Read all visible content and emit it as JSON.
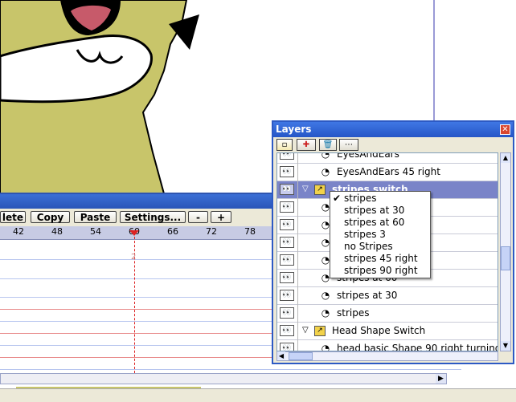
{
  "timeline": {
    "buttons": [
      "lete",
      "Copy",
      "Paste",
      "Settings...",
      "-",
      "+"
    ],
    "ruler_ticks": [
      "42",
      "48",
      "54",
      "60",
      "66",
      "72",
      "78"
    ],
    "current_frame_marker": "2"
  },
  "layers_panel": {
    "title": "Layers",
    "close_symbol": "✕",
    "toolbar_buttons": [
      {
        "icon": "new-layer-icon",
        "glyph": "▫"
      },
      {
        "icon": "duplicate-layer-icon",
        "glyph": "✚"
      },
      {
        "icon": "trash-icon",
        "glyph": "🗑"
      },
      {
        "icon": "more-options-icon",
        "glyph": "⋯"
      }
    ],
    "rows": [
      {
        "label": "EyesAndEars",
        "type": "vector"
      },
      {
        "label": "EyesAndEars 45 right",
        "type": "vector"
      },
      {
        "label": "stripes switch",
        "type": "switch",
        "selected": true
      },
      {
        "label": "",
        "type": "vector"
      },
      {
        "label": "",
        "type": "vector"
      },
      {
        "label": "",
        "type": "vector"
      },
      {
        "label": "",
        "type": "vector"
      },
      {
        "label": "stripes at 60",
        "type": "vector"
      },
      {
        "label": "stripes at 30",
        "type": "vector"
      },
      {
        "label": "stripes",
        "type": "vector"
      },
      {
        "label": "Head Shape Switch",
        "type": "switch"
      },
      {
        "label": "head basic Shape 90 right turning",
        "type": "vector"
      }
    ]
  },
  "switch_menu": {
    "items": [
      "stripes",
      "stripes at 30",
      "stripes at 60",
      "stripes 3",
      "no Stripes",
      "stripes 45 right",
      "stripes 90 right"
    ],
    "checked": "stripes"
  },
  "colors": {
    "cat_body": "#c8c56a",
    "title_blue": "#2d5ac4",
    "selection": "#7a84c8"
  }
}
